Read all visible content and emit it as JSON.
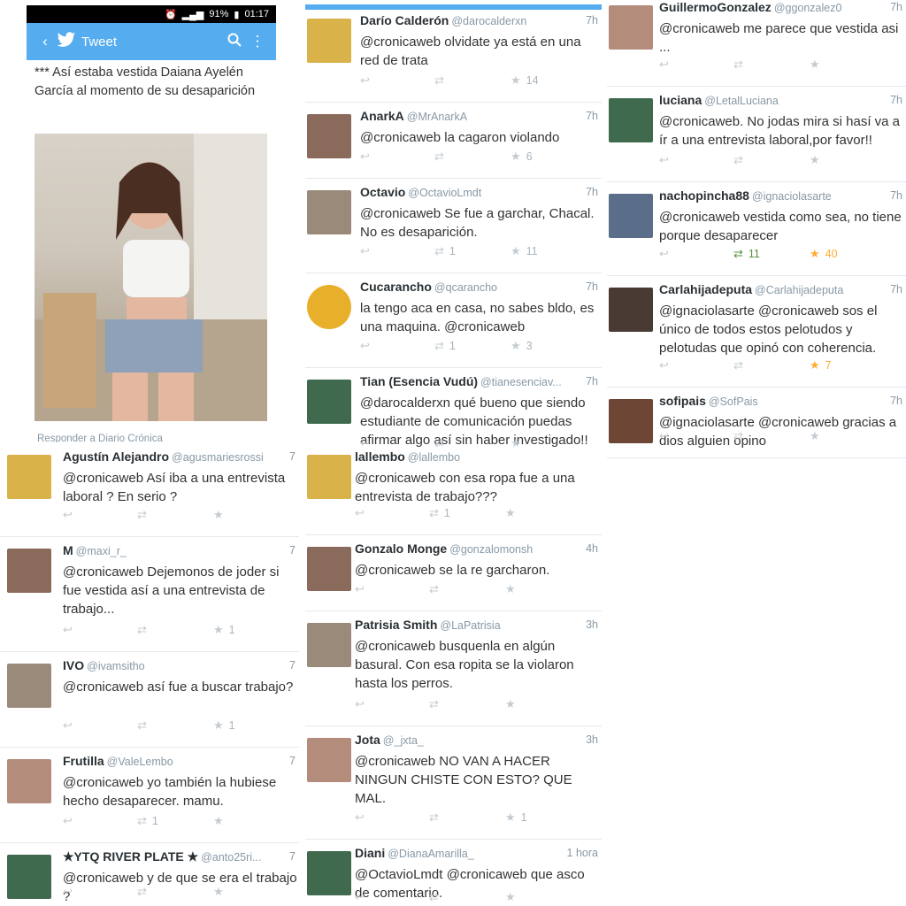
{
  "status": {
    "time": "01:17",
    "battery": "91%"
  },
  "app": {
    "title": "Tweet",
    "back_icon": "back-chevron-icon",
    "logo_icon": "twitter-bird-icon",
    "search_icon": "search-icon",
    "menu_icon": "overflow-menu-icon"
  },
  "main_tweet": {
    "text": "*** Así estaba vestida Daiana Ayelén García al momento de su desaparición",
    "reply_placeholder": "Responder a Diario Crónica"
  },
  "col2_top": [
    {
      "name": "Darío Calderón",
      "handle": "@darocalderxn",
      "time": "7h",
      "text": "@cronicaweb olvidate ya está en una red de trata",
      "rt": "",
      "fav": "14"
    },
    {
      "name": "AnarkA",
      "handle": "@MrAnarkA",
      "time": "7h",
      "text": "@cronicaweb la cagaron violando",
      "rt": "",
      "fav": "6"
    },
    {
      "name": "Octavio",
      "handle": "@OctavioLmdt",
      "time": "7h",
      "text": "@cronicaweb Se fue a garchar, Chacal. No es desaparición.",
      "rt": "1",
      "fav": "11"
    },
    {
      "name": "Cucarancho",
      "handle": "@qcarancho",
      "time": "7h",
      "text": "la tengo aca en casa, no sabes bldo, es una maquina. @cronicaweb",
      "rt": "1",
      "fav": "3"
    },
    {
      "name": "Tian (Esencia Vudú)",
      "handle": "@tianesenciav...",
      "time": "7h",
      "text": "@darocalderxn qué bueno que siendo estudiante de comunicación puedas afirmar algo así sin haber investigado!!",
      "rt": "",
      "fav": ""
    }
  ],
  "col3": [
    {
      "name": "GuillermoGonzalez",
      "handle": "@ggonzalez0",
      "time": "7h",
      "text": "@cronicaweb me parece que vestida asi ...",
      "rt": "",
      "fav": ""
    },
    {
      "name": "luciana",
      "handle": "@LetalLuciana",
      "time": "7h",
      "text": "@cronicaweb. No jodas mira si hasí va a ír a una entrevista laboral,por favor!!",
      "rt": "",
      "fav": ""
    },
    {
      "name": "nachopincha88",
      "handle": "@ignaciolasarte",
      "time": "7h",
      "text": "@cronicaweb vestida como sea, no tiene porque desaparecer",
      "rt": "11",
      "fav": "40"
    },
    {
      "name": "Carlahijadeputa",
      "handle": "@Carlahijadeputa",
      "time": "7h",
      "text": "@ignaciolasarte @cronicaweb sos el único de todos estos pelotudos y pelotudas que opinó con coherencia.",
      "rt": "",
      "fav": "7"
    },
    {
      "name": "sofipais",
      "handle": "@SofPais",
      "time": "7h",
      "text": "@ignaciolasarte @cronicaweb gracias a dios alguien opino",
      "rt": "",
      "fav": ""
    }
  ],
  "col1_bottom": [
    {
      "name": "Agustín Alejandro",
      "handle": "@agusmariesrossi",
      "time": "7",
      "text": "@cronicaweb Así iba a una entrevista laboral ? En serio ?",
      "rt": "",
      "fav": ""
    },
    {
      "name": "M",
      "handle": "@maxi_r_",
      "time": "7",
      "text": "@cronicaweb Dejemonos de joder si fue vestida así a una entrevista de trabajo...",
      "rt": "",
      "fav": "1"
    },
    {
      "name": "IVO",
      "handle": "@ivamsitho",
      "time": "7",
      "text": "@cronicaweb así fue a buscar trabajo?",
      "rt": "",
      "fav": "1"
    },
    {
      "name": "Frutilla",
      "handle": "@ValeLembo",
      "time": "7",
      "text": "@cronicaweb yo también la hubiese hecho desaparecer. mamu.",
      "rt": "1",
      "fav": ""
    },
    {
      "name": "★YTQ RIVER PLATE ★",
      "handle": "@anto25ri...",
      "time": "7",
      "text": "@cronicaweb y de que se era el trabajo ?",
      "rt": "",
      "fav": ""
    }
  ],
  "col2_bottom": [
    {
      "name": "lallembo",
      "handle": "@lallembo",
      "time": "",
      "text": "@cronicaweb con esa ropa fue a una entrevista de trabajo???",
      "rt": "1",
      "fav": ""
    },
    {
      "name": "Gonzalo Monge",
      "handle": "@gonzalomonsh",
      "time": "4h",
      "text": "@cronicaweb se la re garcharon.",
      "rt": "",
      "fav": ""
    },
    {
      "name": "Patrisia Smith",
      "handle": "@LaPatrisia",
      "time": "3h",
      "text": "@cronicaweb busquenla  en algún basural. Con esa ropita se la violaron hasta los perros.",
      "rt": "",
      "fav": ""
    },
    {
      "name": "Jota",
      "handle": "@_jxta_",
      "time": "3h",
      "text": "@cronicaweb NO VAN A HACER NINGUN CHISTE CON ESTO? QUE MAL.",
      "rt": "",
      "fav": "1"
    },
    {
      "name": "Diani",
      "handle": "@DianaAmarilla_",
      "time": "1 hora",
      "text": "@OctavioLmdt @cronicaweb que asco de comentario.",
      "rt": "",
      "fav": ""
    }
  ],
  "icons": {
    "reply": "reply-icon",
    "retweet": "retweet-icon",
    "favorite": "star-icon"
  },
  "colors": {
    "twitter_blue": "#55acee",
    "retweet_active": "#5c913b",
    "favorite_active": "#ffac33"
  }
}
